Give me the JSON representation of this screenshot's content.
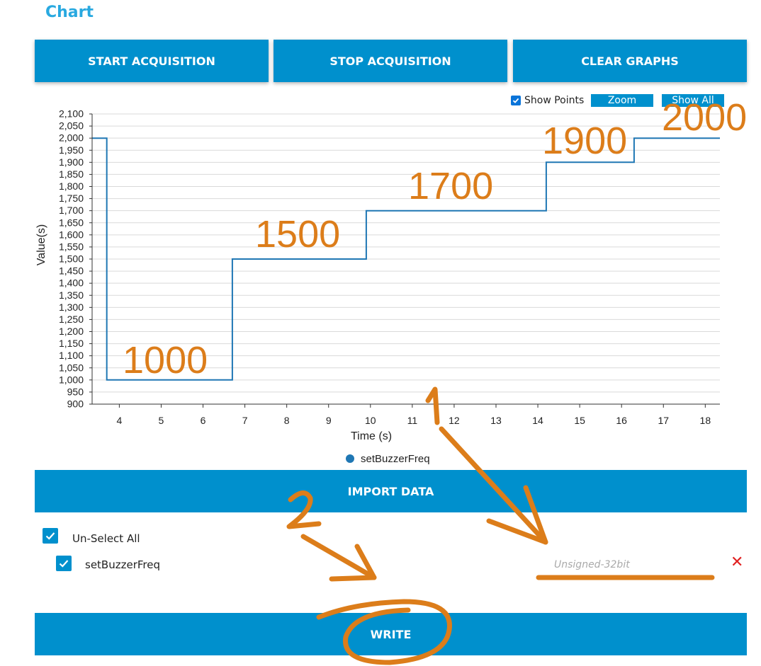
{
  "page_title": "Chart",
  "toolbar": {
    "start_label": "START ACQUISITION",
    "stop_label": "STOP ACQUISITION",
    "clear_label": "CLEAR GRAPHS"
  },
  "chart_controls": {
    "show_points_label": "Show Points",
    "show_points_checked": true,
    "zoom_label": "Zoom",
    "show_all_label": "Show All"
  },
  "chart_data": {
    "type": "line",
    "step": true,
    "xlabel": "Time (s)",
    "ylabel": "Value(s)",
    "xlim": [
      3.35,
      18.35
    ],
    "ylim": [
      900,
      2100
    ],
    "x_ticks": [
      4,
      5,
      6,
      7,
      8,
      9,
      10,
      11,
      12,
      13,
      14,
      15,
      16,
      17,
      18
    ],
    "y_ticks": [
      900,
      950,
      1000,
      1050,
      1100,
      1150,
      1200,
      1250,
      1300,
      1350,
      1400,
      1450,
      1500,
      1550,
      1600,
      1650,
      1700,
      1750,
      1800,
      1850,
      1900,
      1950,
      2000,
      2050,
      2100
    ],
    "y_tick_labels": [
      "900",
      "950",
      "1,000",
      "1,050",
      "1,100",
      "1,150",
      "1,200",
      "1,250",
      "1,300",
      "1,350",
      "1,400",
      "1,450",
      "1,500",
      "1,550",
      "1,600",
      "1,650",
      "1,700",
      "1,750",
      "1,800",
      "1,850",
      "1,900",
      "1,950",
      "2,000",
      "2,050",
      "2,100"
    ],
    "grid": true,
    "legend_position": "bottom",
    "series": [
      {
        "name": "setBuzzerFreq",
        "color": "#1f77b4",
        "x": [
          3.35,
          3.7,
          3.7,
          6.7,
          6.7,
          9.9,
          9.9,
          14.2,
          14.2,
          16.3,
          16.3,
          18.35
        ],
        "y": [
          2000,
          2000,
          1000,
          1000,
          1500,
          1500,
          1700,
          1700,
          1900,
          1900,
          2000,
          2000
        ]
      }
    ]
  },
  "annotations": {
    "color": "#dc7d1a",
    "labels": [
      "1000",
      "1500",
      "1700",
      "1900",
      "2000",
      "1",
      "2"
    ]
  },
  "import_label": "IMPORT DATA",
  "selection": {
    "unselect_all_label": "Un-Select All",
    "item_label": "setBuzzerFreq",
    "type_placeholder": "Unsigned-32bit",
    "remove_symbol": "✕"
  },
  "write_label": "WRITE",
  "colors": {
    "accent": "#0090cd",
    "title": "#29a9e0",
    "remove": "#e02020"
  }
}
